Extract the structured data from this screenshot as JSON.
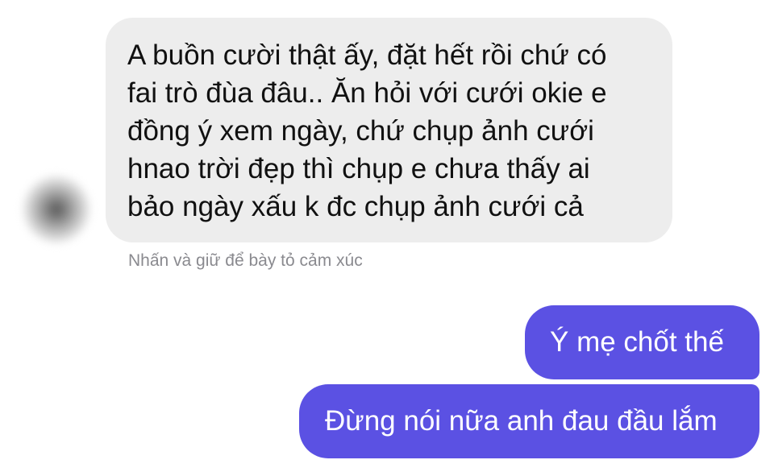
{
  "conversation": {
    "incoming": {
      "lines": [
        "A buồn cười thật ấy, đặt hết rồi chứ có",
        "fai trò đùa đâu.. Ăn hỏi với cưới okie e",
        "đồng ý xem ngày, chứ chụp ảnh cưới",
        "hnao trời đẹp thì chụp e chưa thấy ai",
        "bảo ngày xấu k đc chụp ảnh cưới cả"
      ]
    },
    "reaction_hint": "Nhấn và giữ để bày tỏ cảm xúc",
    "outgoing": [
      "Ý mẹ chốt thế",
      "Đừng nói nữa anh đau đầu lắm"
    ]
  },
  "colors": {
    "incoming_bubble": "#ededed",
    "outgoing_bubble": "#5b51e3",
    "hint_text": "#8a8a8f"
  }
}
